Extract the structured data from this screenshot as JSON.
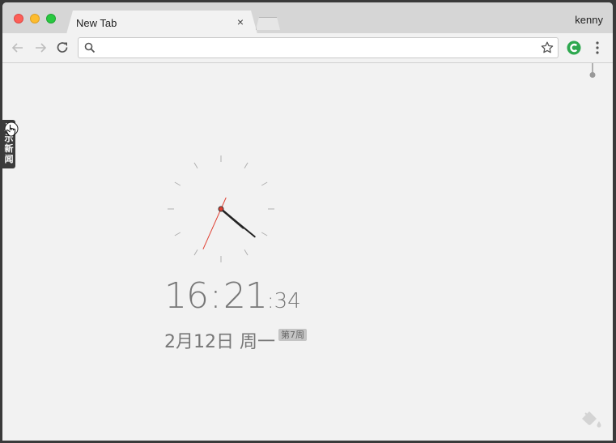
{
  "window": {
    "tab": {
      "title": "New Tab",
      "close_label": "×"
    },
    "profile_name": "kenny"
  },
  "toolbar": {
    "omnibox": {
      "value": "",
      "placeholder": ""
    }
  },
  "icons": {
    "back": "arrow-left",
    "forward": "arrow-right",
    "reload": "reload",
    "search": "magnifier",
    "star": "star-outline",
    "extension": "green-c-extension",
    "menu": "vertical-dots",
    "paint": "paint-bucket",
    "pin": "pin"
  },
  "side_tab": {
    "label": "显示新闻"
  },
  "clock": {
    "hours": 16,
    "minutes": 21,
    "seconds": 34
  },
  "time": {
    "hours": "16",
    "minutes": "21",
    "seconds": "34",
    "sep1": ":",
    "sep2": ":"
  },
  "date": {
    "text": "2月12日 周一",
    "week": "第7周"
  },
  "colors": {
    "accent_red": "#e03d2f",
    "extension_green": "#2ea84f",
    "text_gray": "#777777",
    "background": "#f2f2f2"
  }
}
